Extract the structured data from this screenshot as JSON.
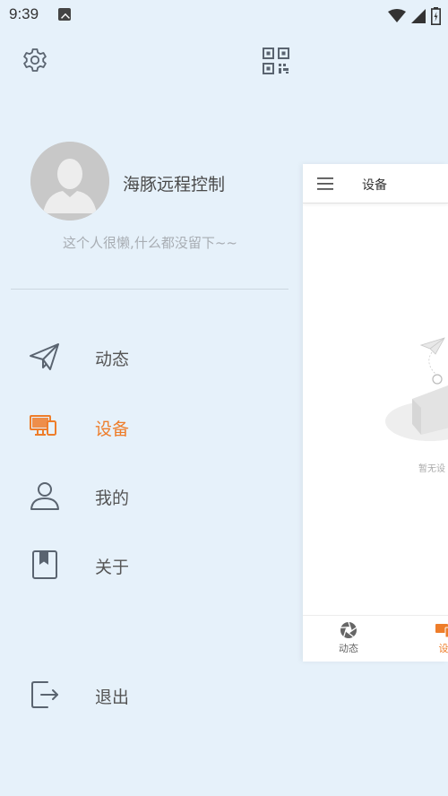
{
  "status_bar": {
    "time": "9:39"
  },
  "header": {
    "settings_icon": "gear-icon",
    "qr_icon": "qr-code-icon"
  },
  "profile": {
    "name": "海豚远程控制",
    "bio": "这个人很懒,什么都没留下~~"
  },
  "menu": {
    "items": [
      {
        "label": "动态",
        "icon": "paper-plane-icon"
      },
      {
        "label": "设备",
        "icon": "devices-icon",
        "active": true
      },
      {
        "label": "我的",
        "icon": "person-icon"
      },
      {
        "label": "关于",
        "icon": "bookmark-book-icon"
      }
    ],
    "logout": {
      "label": "退出",
      "icon": "logout-icon"
    }
  },
  "preview": {
    "title": "设备",
    "empty_text": "暂无设",
    "tabs": [
      {
        "label": "动态",
        "icon": "aperture-icon"
      },
      {
        "label": "设",
        "icon": "devices-icon",
        "active": true
      }
    ]
  },
  "colors": {
    "accent": "#ee7d2a",
    "drawer_bg": "#e6f1fa",
    "icon_gray": "#5a6470"
  }
}
